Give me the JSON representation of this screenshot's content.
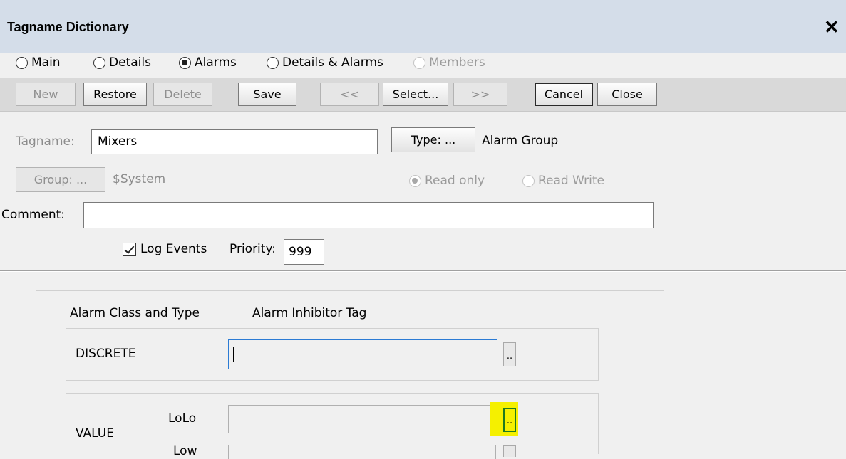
{
  "window": {
    "title": "Tagname Dictionary",
    "close_glyph": "✕"
  },
  "view_modes": {
    "options": [
      "Main",
      "Details",
      "Alarms",
      "Details & Alarms",
      "Members"
    ],
    "selected": "Alarms",
    "disabled": [
      "Members"
    ]
  },
  "toolbar": {
    "new": "New",
    "restore": "Restore",
    "delete": "Delete",
    "save": "Save",
    "prev": "<<",
    "select": "Select...",
    "next": ">>",
    "cancel": "Cancel",
    "close": "Close"
  },
  "tag": {
    "tagname_label": "Tagname:",
    "tagname_value": "Mixers",
    "type_button": "Type: ...",
    "type_value": "Alarm Group",
    "group_button": "Group: ...",
    "group_value": "$System",
    "access_options": [
      "Read only",
      "Read Write"
    ],
    "access_selected": "Read only",
    "comment_label": "Comment:",
    "comment_value": "",
    "log_events_label": "Log Events",
    "log_events_checked": true,
    "priority_label": "Priority:",
    "priority_value": "999"
  },
  "alarms": {
    "header_class": "Alarm Class and Type",
    "header_inhibitor": "Alarm Inhibitor Tag",
    "discrete_label": "DISCRETE",
    "value_label": "VALUE",
    "lolo_label": "LoLo",
    "low_label": "Low",
    "ellipsis": ".."
  },
  "colors": {
    "highlight": "#f5f000",
    "focus_border": "#2b7bd4",
    "title_bg": "#d4dde9"
  }
}
